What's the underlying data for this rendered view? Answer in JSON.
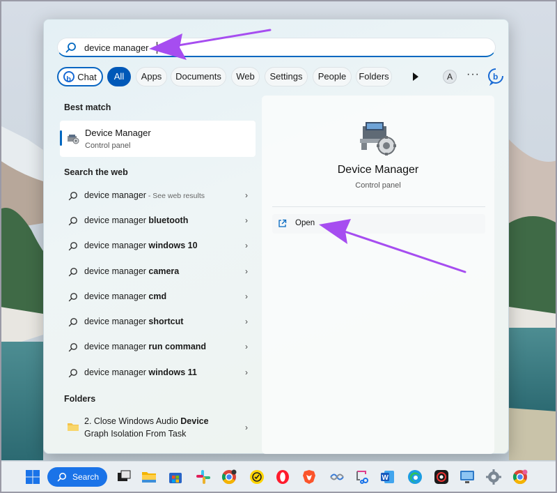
{
  "search": {
    "value": "device manager"
  },
  "filters": {
    "items": [
      {
        "label": "Chat"
      },
      {
        "label": "All"
      },
      {
        "label": "Apps"
      },
      {
        "label": "Documents"
      },
      {
        "label": "Web"
      },
      {
        "label": "Settings"
      },
      {
        "label": "People"
      },
      {
        "label": "Folders"
      }
    ],
    "active": "All",
    "avatar_letter": "A"
  },
  "best_match": {
    "heading": "Best match",
    "title": "Device Manager",
    "subtitle": "Control panel"
  },
  "web": {
    "heading": "Search the web",
    "rows": [
      {
        "prefix": "device manager",
        "bold": "",
        "hint": " - See web results"
      },
      {
        "prefix": "device manager ",
        "bold": "bluetooth",
        "hint": ""
      },
      {
        "prefix": "device manager ",
        "bold": "windows 10",
        "hint": ""
      },
      {
        "prefix": "device manager ",
        "bold": "camera",
        "hint": ""
      },
      {
        "prefix": "device manager ",
        "bold": "cmd",
        "hint": ""
      },
      {
        "prefix": "device manager ",
        "bold": "shortcut",
        "hint": ""
      },
      {
        "prefix": "device manager ",
        "bold": "run command",
        "hint": ""
      },
      {
        "prefix": "device manager ",
        "bold": "windows 11",
        "hint": ""
      }
    ]
  },
  "folders": {
    "heading": "Folders",
    "item": {
      "line1_prefix": "2. Close Windows Audio ",
      "line1_bold": "Device",
      "line2": "Graph Isolation From Task"
    }
  },
  "detail": {
    "title": "Device Manager",
    "subtitle": "Control panel",
    "open_label": "Open"
  },
  "taskbar": {
    "search_label": "Search",
    "apps": [
      "windows-start",
      "search",
      "task-view",
      "file-explorer",
      "microsoft-store",
      "slack",
      "chrome",
      "norton",
      "opera",
      "brave",
      "network-tool",
      "snipping-tool",
      "word",
      "edge",
      "davinci-resolve",
      "remote-desktop",
      "settings",
      "chrome-alt"
    ]
  },
  "colors": {
    "accent": "#0067c0",
    "annotation_arrow": "#a64df0"
  }
}
